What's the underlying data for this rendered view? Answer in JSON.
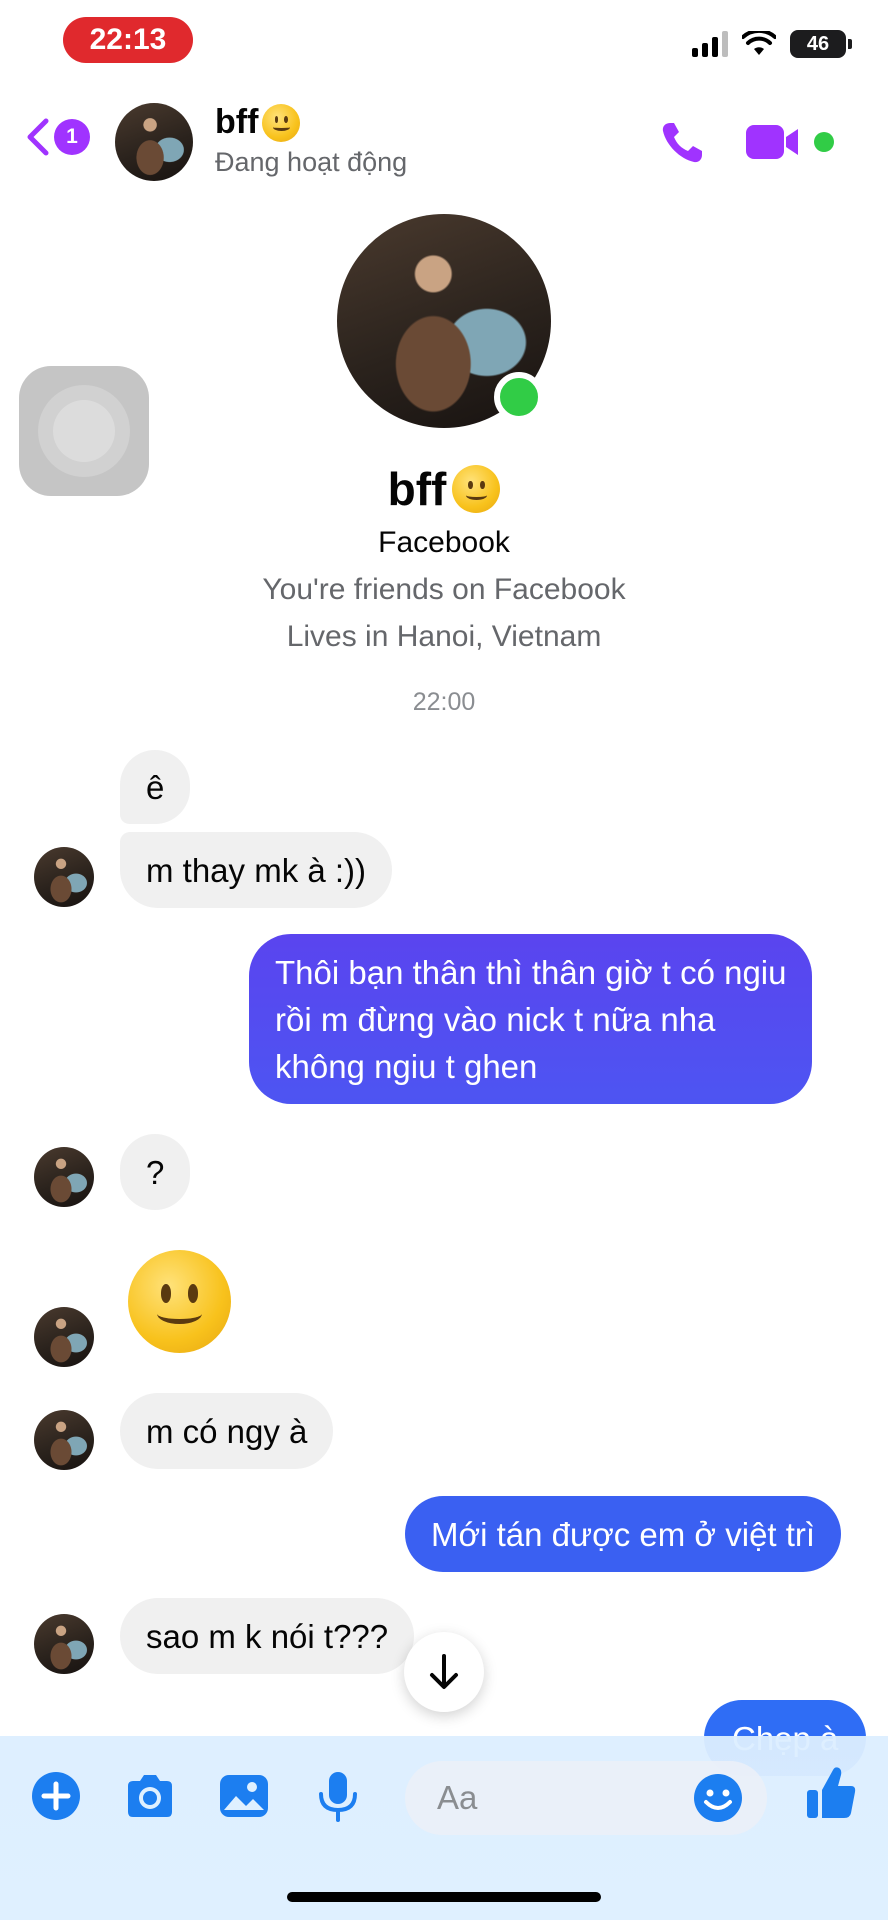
{
  "status_bar": {
    "time": "22:13",
    "battery": "46"
  },
  "header": {
    "unread_count": "1",
    "contact_name": "bff",
    "contact_status": "Đang hoạt động"
  },
  "profile": {
    "name": "bff",
    "source": "Facebook",
    "friends_text": "You're friends on Facebook",
    "lives_text": "Lives in Hanoi, Vietnam"
  },
  "conversation": {
    "timestamp": "22:00",
    "messages": [
      {
        "from": "them",
        "text": "ê"
      },
      {
        "from": "them",
        "text": "m thay mk à :))"
      },
      {
        "from": "me",
        "lines": [
          "Thôi bạn thân thì thân giờ t có ngiu",
          "rồi m đừng vào nick t nữa nha",
          "không ngiu t ghen"
        ]
      },
      {
        "from": "them",
        "text": "?"
      },
      {
        "from": "them",
        "emoji": "slightly-smiling-face"
      },
      {
        "from": "them",
        "text": "m có ngy à"
      },
      {
        "from": "me",
        "text": "Mới tán được em ở việt trì"
      },
      {
        "from": "them",
        "text": "sao m k nói t???"
      },
      {
        "from": "me",
        "text": "Chẹp à"
      }
    ]
  },
  "composer": {
    "placeholder": "Aa"
  },
  "colors": {
    "accent": "#a033ff",
    "outgoing_gradient_top": "#5a44ef",
    "outgoing_gradient_bottom": "#2f6df5",
    "online": "#31cc46",
    "composer_icons": "#1c7ef0"
  }
}
